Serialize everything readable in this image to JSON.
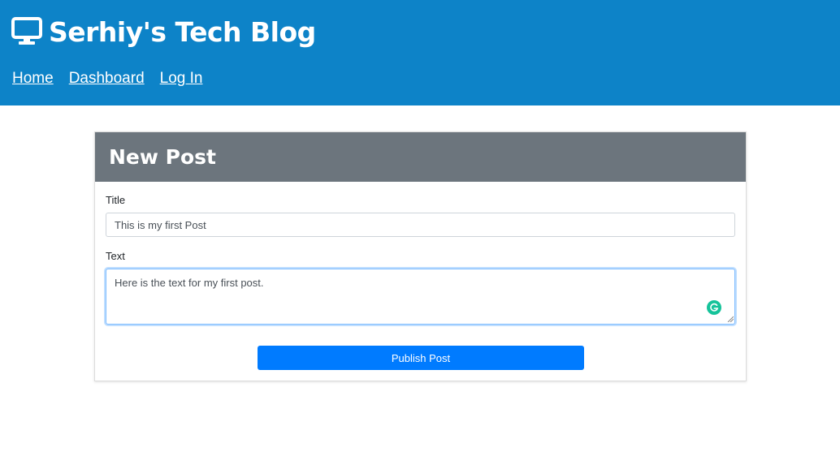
{
  "header": {
    "brand_title": "Serhiy's Tech Blog",
    "brand_icon": "monitor-icon",
    "nav": [
      {
        "label": "Home"
      },
      {
        "label": "Dashboard"
      },
      {
        "label": "Log In"
      }
    ]
  },
  "form": {
    "heading": "New Post",
    "title_label": "Title",
    "title_value": "This is my first Post",
    "text_label": "Text",
    "text_value": "Here is the text for my first post.",
    "grammarly_icon": "grammarly-icon",
    "submit_label": "Publish Post"
  },
  "colors": {
    "header_bg": "#0d83c8",
    "card_header_bg": "#6c757d",
    "button_bg": "#007bff"
  }
}
